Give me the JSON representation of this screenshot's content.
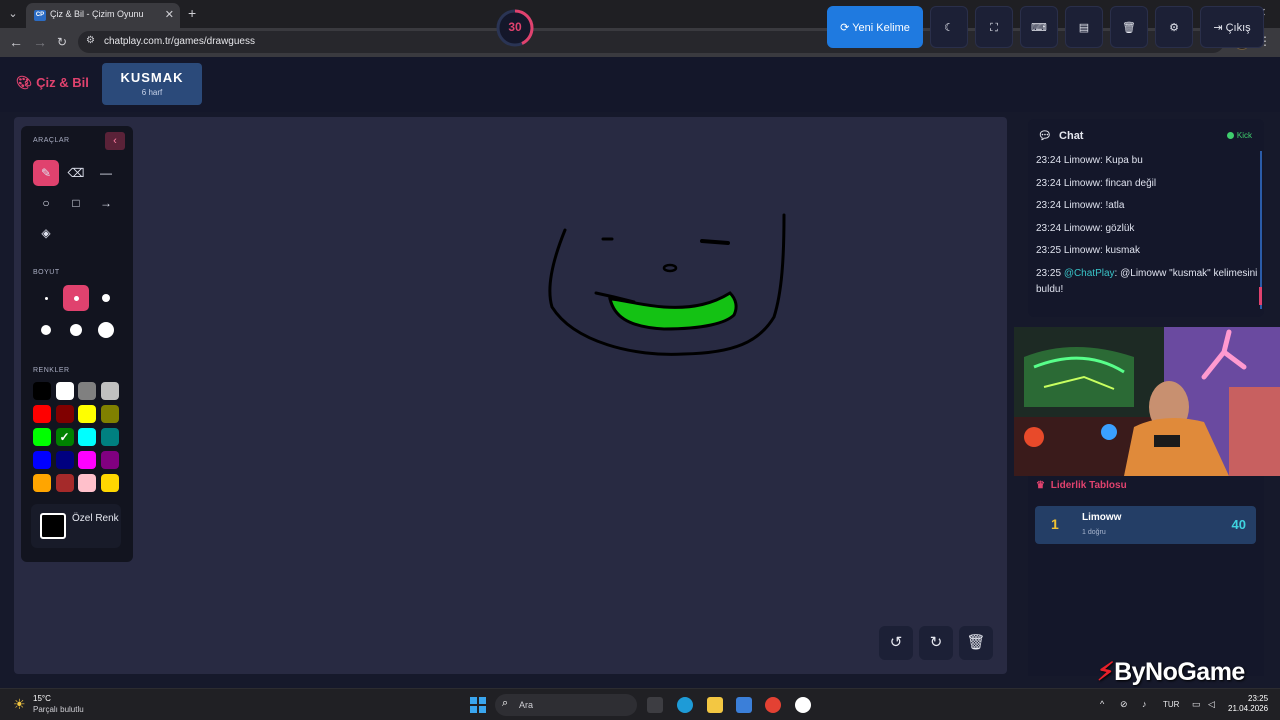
{
  "browser": {
    "tab_title": "Çiz & Bil - Çizim Oyunu",
    "tab_favicon": "CP",
    "url": "chatplay.com.tr/games/drawguess"
  },
  "header": {
    "logo_text": "Çiz & Bil",
    "word": "KUSMAK",
    "word_hint": "6 harf",
    "timer": "30",
    "new_word_label": "Yeni Kelime",
    "exit_label": "Çıkış"
  },
  "tools": {
    "title": "ARAÇLAR",
    "size_title": "BOYUT",
    "colors_title": "RENKLER",
    "custom_color_label": "Özel Renk",
    "colors": [
      "#000000",
      "#ffffff",
      "#808080",
      "#c0c0c0",
      "#ff0000",
      "#800000",
      "#ffff00",
      "#808000",
      "#00ff00",
      "#008000",
      "#00ffff",
      "#008080",
      "#0000ff",
      "#000080",
      "#ff00ff",
      "#800080",
      "#ffa500",
      "#a52a2a",
      "#ffc0cb",
      "#ffd700"
    ],
    "selected_color": "#008000",
    "active_tool": "pen-icon",
    "active_size": 2
  },
  "chat": {
    "title": "Chat",
    "status": "Kick",
    "messages": [
      {
        "time": "23:24",
        "user": "Limoww",
        "text": "Kupa bu"
      },
      {
        "time": "23:24",
        "user": "Limoww",
        "text": "fincan değil"
      },
      {
        "time": "23:24",
        "user": "Limoww",
        "text": "!atla"
      },
      {
        "time": "23:24",
        "user": "Limoww",
        "text": "gözlük"
      },
      {
        "time": "23:25",
        "user": "Limoww",
        "text": "kusmak"
      },
      {
        "time": "23:25",
        "user": "@ChatPlay",
        "text": "@Limoww \"kusmak\" kelimesini buldu!"
      }
    ]
  },
  "leaderboard": {
    "title": "Liderlik Tablosu",
    "rows": [
      {
        "rank": "1",
        "name": "Limoww",
        "sub": "1 doğru",
        "score": "40"
      }
    ]
  },
  "watermark": "ByNoGame",
  "taskbar": {
    "weather_temp": "15°C",
    "weather_desc": "Parçalı bulutlu",
    "search_placeholder": "Ara",
    "lang": "TUR",
    "time": "23:25",
    "date": "21.04.2026"
  }
}
